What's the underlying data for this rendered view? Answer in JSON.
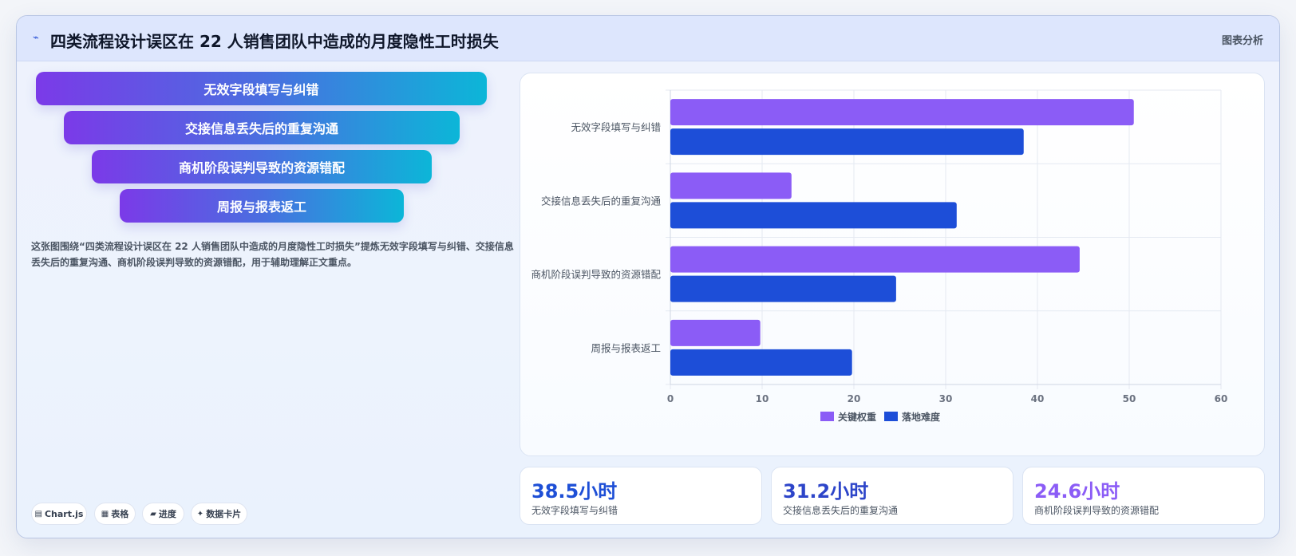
{
  "header": {
    "icon": "⌁",
    "title": "四类流程设计误区在 22 人销售团队中造成的月度隐性工时损失",
    "tag": "图表分析"
  },
  "funnel": [
    {
      "label": "无效字段填写与纠错"
    },
    {
      "label": "交接信息丢失后的重复沟通"
    },
    {
      "label": "商机阶段误判导致的资源错配"
    },
    {
      "label": "周报与报表返工"
    }
  ],
  "description": "这张图围绕“四类流程设计误区在 22 人销售团队中造成的月度隐性工时损失”提炼无效字段填写与纠错、交接信息丢失后的重复沟通、商机阶段误判导致的资源错配，用于辅助理解正文重点。",
  "chips": [
    {
      "icon": "▤",
      "label": "Chart.js"
    },
    {
      "icon": "▦",
      "label": "表格"
    },
    {
      "icon": "▰",
      "label": "进度"
    },
    {
      "icon": "✦",
      "label": "数据卡片"
    }
  ],
  "stats": [
    {
      "value": "38.5小时",
      "label": "无效字段填写与纠错",
      "color": "#1e4fd6"
    },
    {
      "value": "31.2小时",
      "label": "交接信息丢失后的重复沟通",
      "color": "#2d45c9"
    },
    {
      "value": "24.6小时",
      "label": "商机阶段误判导致的资源错配",
      "color": "#8b5cf6"
    }
  ],
  "chart_data": {
    "type": "bar",
    "orientation": "horizontal",
    "categories": [
      "无效字段填写与纠错",
      "交接信息丢失后的重复沟通",
      "商机阶段误判导致的资源错配",
      "周报与报表返工"
    ],
    "series": [
      {
        "name": "关键权重",
        "values": [
          50.5,
          13.2,
          44.6,
          9.8
        ],
        "color": "#8b5cf6"
      },
      {
        "name": "落地难度",
        "values": [
          38.5,
          31.2,
          24.6,
          19.8
        ],
        "color": "#1d4ed8"
      }
    ],
    "xlim": [
      0,
      60
    ],
    "ticks": [
      "0",
      "10",
      "20",
      "30",
      "40",
      "50",
      "60"
    ],
    "grid": true,
    "legend": "bottom"
  }
}
